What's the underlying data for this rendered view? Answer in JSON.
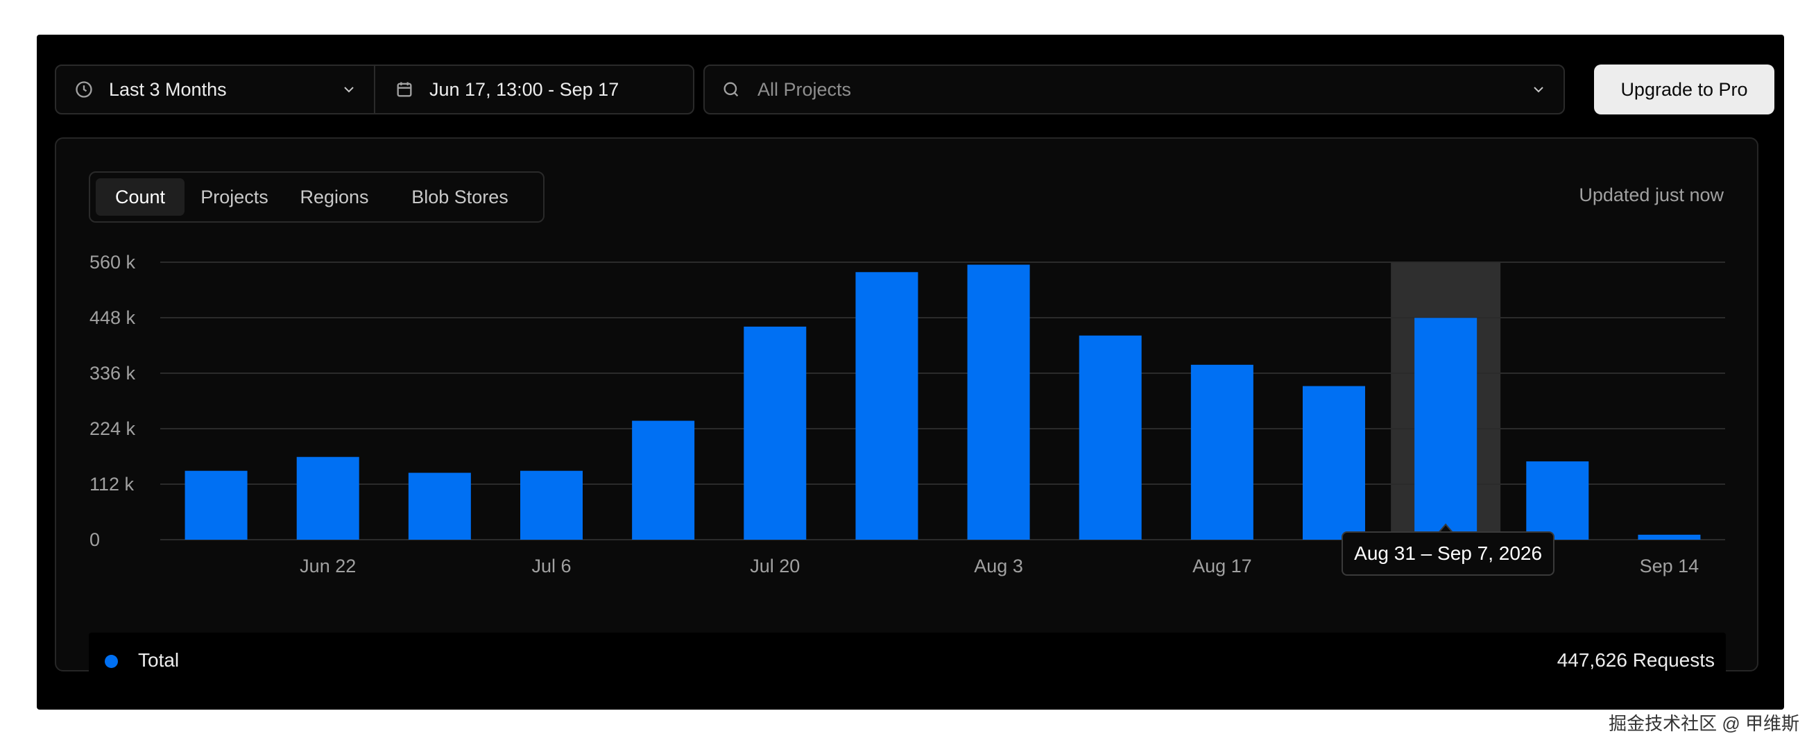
{
  "toolbar": {
    "range_label": "Last 3 Months",
    "date_label": "Jun 17, 13:00 - Sep 17",
    "search_placeholder": "All Projects",
    "upgrade_label": "Upgrade to Pro"
  },
  "tabs": [
    "Count",
    "Projects",
    "Regions",
    "Blob Stores"
  ],
  "updated": "Updated just now",
  "tooltip": "Aug 31 – Sep 7, 2026",
  "legend": {
    "label": "Total",
    "value": "447,626 Requests"
  },
  "watermark": "掘金技术社区 @ 甲维斯",
  "colors": {
    "bar": "#0070f3",
    "highlight": "#2f2f2f",
    "grid": "#2b2b2b"
  },
  "chart_data": {
    "type": "bar",
    "y_ticks": [
      "560 k",
      "448 k",
      "336 k",
      "224 k",
      "112 k",
      "0"
    ],
    "ylim": [
      0,
      560000
    ],
    "x_labels": [
      "Jun 22",
      "Jul 6",
      "Jul 20",
      "Aug 3",
      "Aug 17",
      "Aug 31",
      "Sep 14"
    ],
    "values": [
      139000,
      167000,
      135000,
      139000,
      240000,
      430000,
      540000,
      555000,
      412000,
      353000,
      310000,
      447626,
      158000,
      10000
    ],
    "highlight_index": 11
  }
}
